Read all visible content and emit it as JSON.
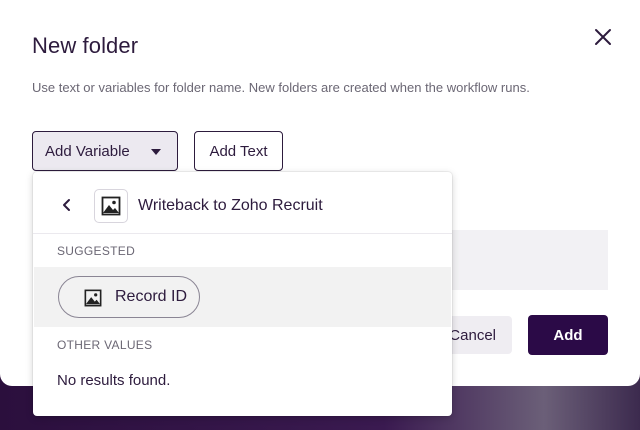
{
  "modal": {
    "title": "New folder",
    "subtitle": "Use text or variables for folder name. New folders are created when the workflow runs.",
    "add_variable_label": "Add Variable",
    "add_text_label": "Add Text",
    "cancel_label": "Cancel",
    "add_label": "Add"
  },
  "dropdown": {
    "app_name": "Writeback to Zoho Recruit",
    "suggested_label": "SUGGESTED",
    "suggested_items": [
      {
        "label": "Record ID",
        "icon": "image-icon"
      }
    ],
    "other_values_label": "OTHER VALUES",
    "no_results": "No results found."
  },
  "colors": {
    "primary": "#2b0a47",
    "text": "#2d1b3d",
    "muted": "#6b6774"
  }
}
